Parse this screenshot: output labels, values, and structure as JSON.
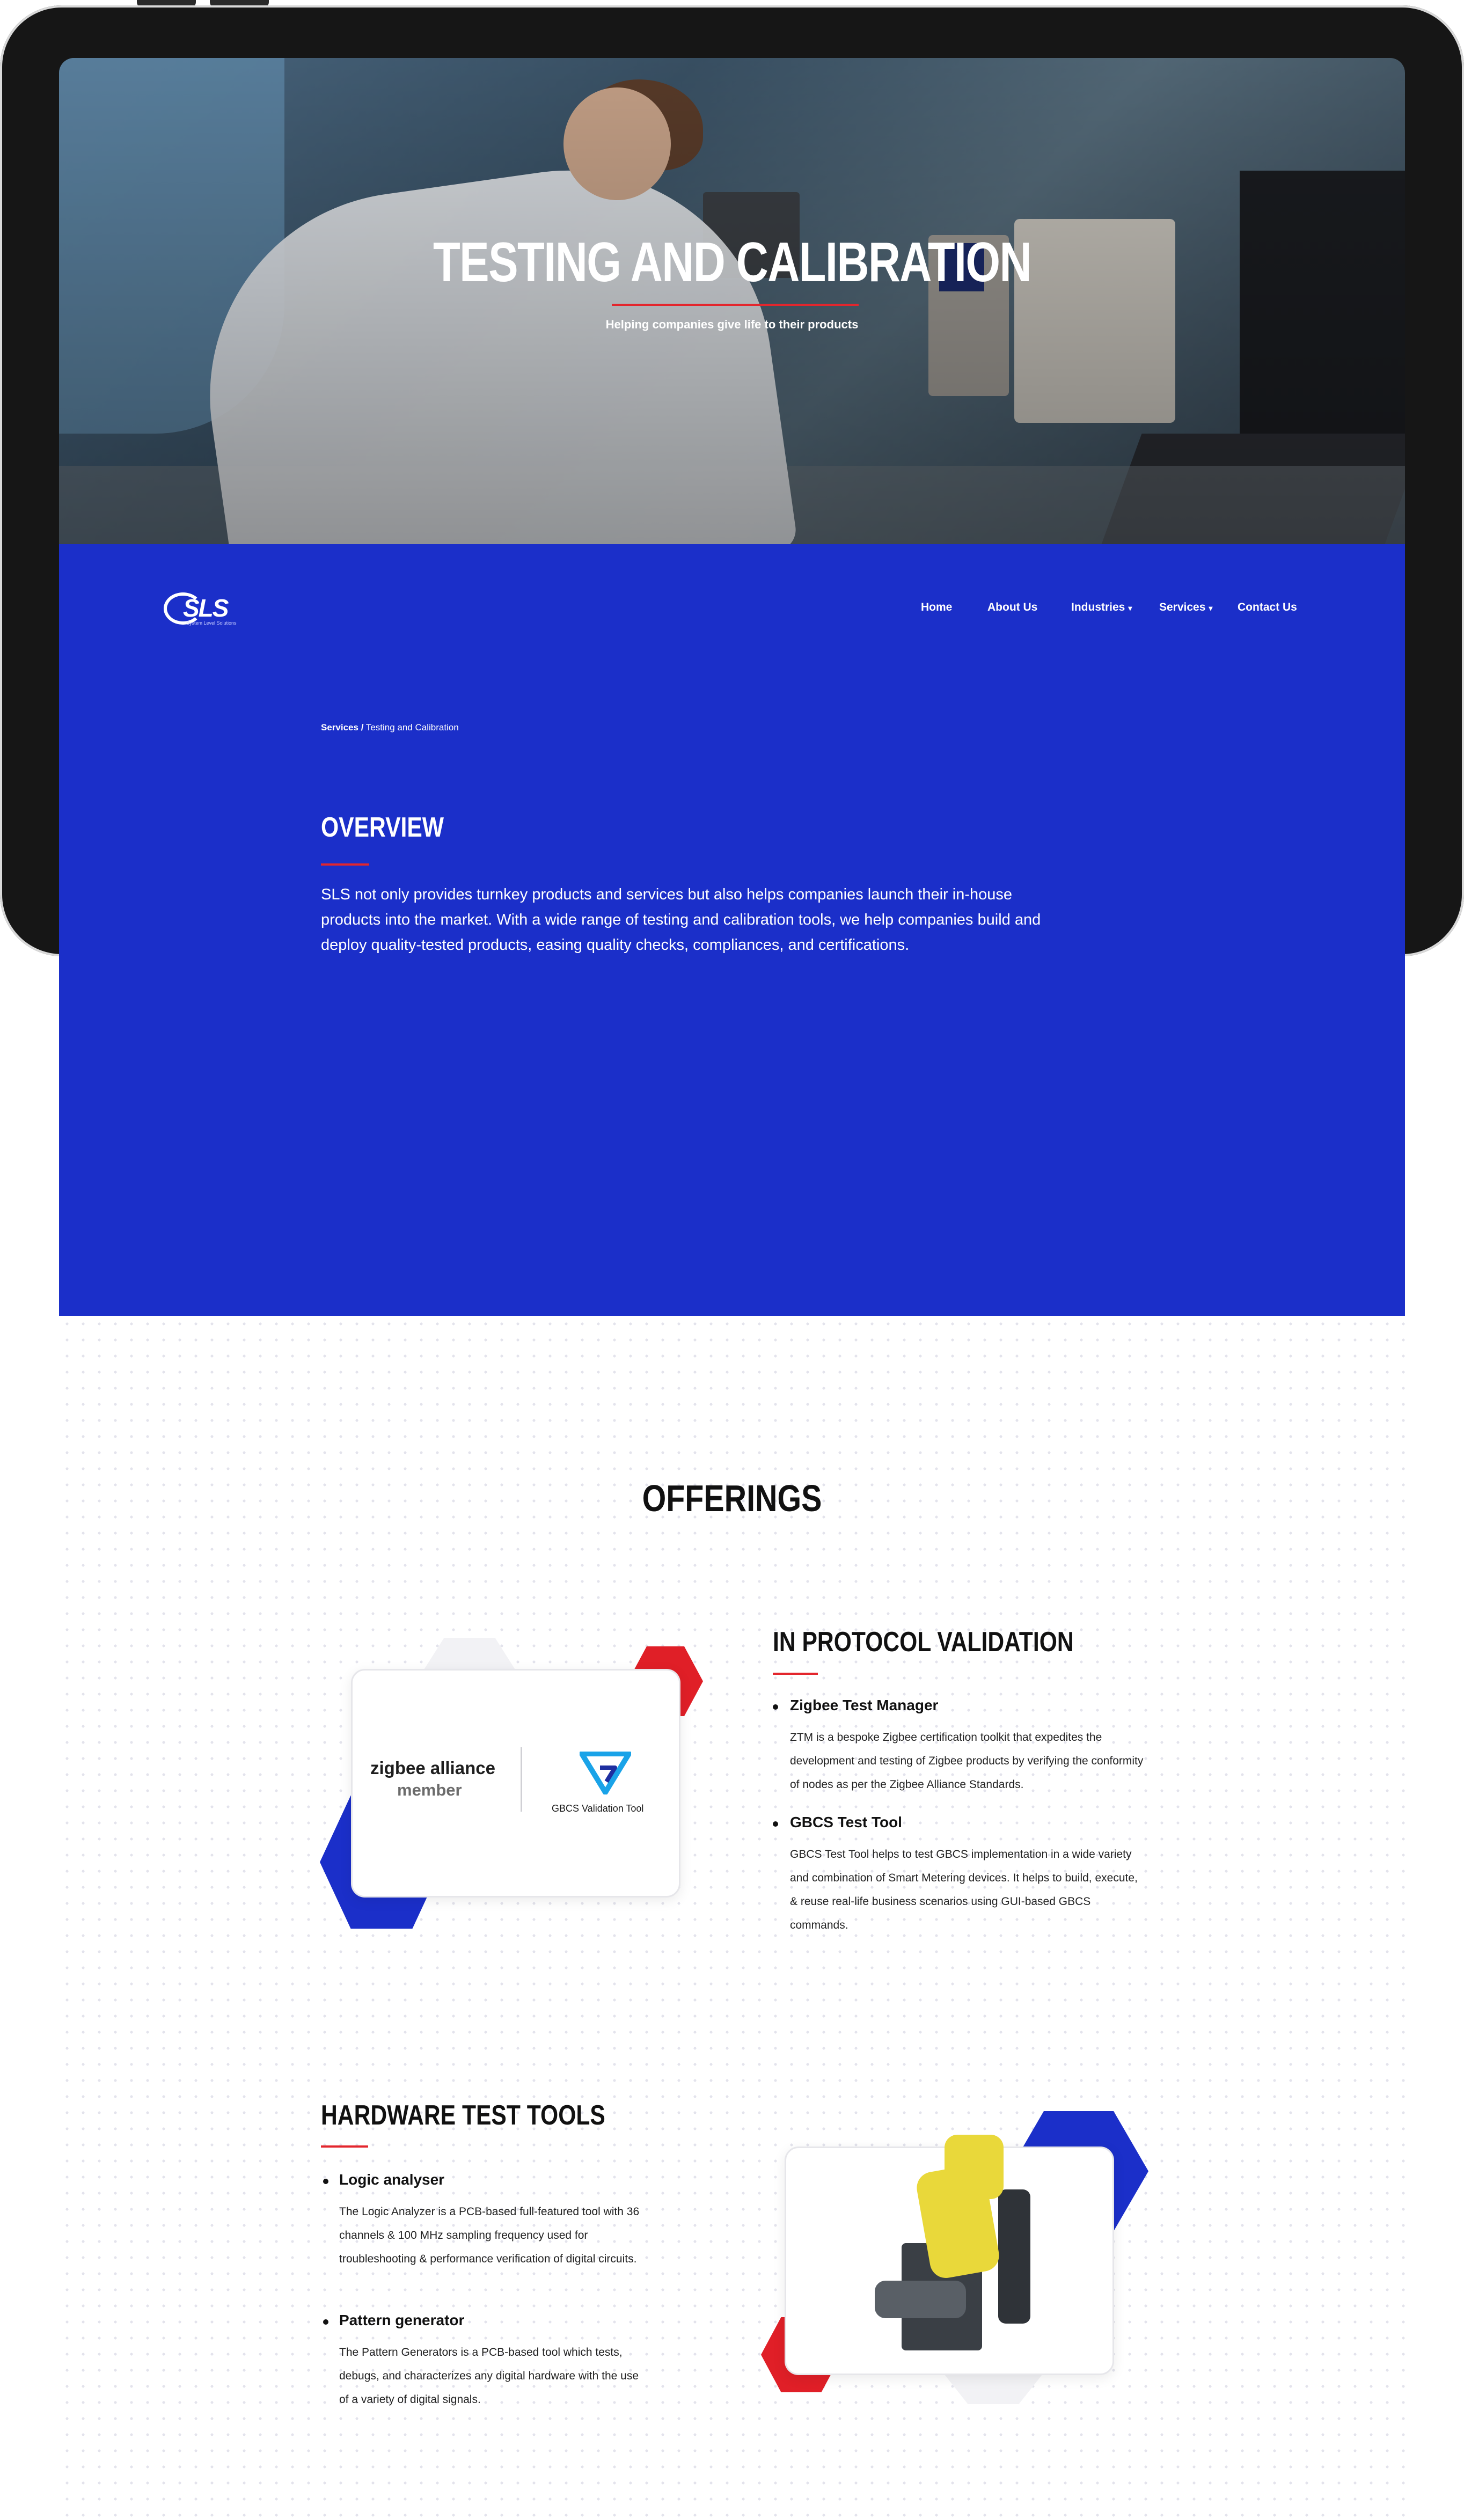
{
  "hero": {
    "title": "TESTING AND CALIBRATION",
    "subtitle": "Helping companies give life to their products"
  },
  "brand": {
    "logo_text": "SLS",
    "tagline": "System Level Solutions"
  },
  "nav": {
    "items": [
      {
        "label": "Home"
      },
      {
        "label": "About Us"
      },
      {
        "label": "Industries",
        "dropdown": true
      },
      {
        "label": "Services",
        "dropdown": true
      },
      {
        "label": "Contact Us"
      }
    ],
    "caret": "▾"
  },
  "breadcrumb": {
    "parent": "Services",
    "separator": "/",
    "current": "Testing and Calibration"
  },
  "overview": {
    "heading": "OVERVIEW",
    "text": "SLS not only provides turnkey products and services but also helps companies launch their in-house products into the market. With a wide range of testing and calibration tools, we help companies build and deploy quality-tested products, easing quality checks, compliances, and certifications."
  },
  "offerings": {
    "title": "OFFERINGS",
    "protocol": {
      "heading": "IN PROTOCOL VALIDATION",
      "items": [
        {
          "title": "Zigbee Test Manager",
          "text": "ZTM is a bespoke Zigbee certification toolkit that expedites the development and testing of Zigbee products by verifying the conformity of nodes as per the Zigbee Alliance Standards."
        },
        {
          "title": "GBCS Test Tool",
          "text": "GBCS Test Tool helps to test GBCS implementation in a wide variety and combination of Smart Metering devices. It helps to build, execute, & reuse real-life business scenarios using GUI-based GBCS commands."
        }
      ],
      "card": {
        "zigbee_line1": "zigbee alliance",
        "zigbee_line2": "member",
        "gbcs_label": "GBCS Validation Tool"
      }
    },
    "hardware": {
      "heading": "HARDWARE TEST TOOLS",
      "items": [
        {
          "title": "Logic analyser",
          "text": "The Logic Analyzer is a PCB-based full-featured tool with 36 channels & 100 MHz sampling frequency used for troubleshooting & performance verification of digital circuits."
        },
        {
          "title": "Pattern generator",
          "text": "The Pattern Generators is a PCB-based tool which tests, debugs, and characterizes any digital hardware with the use of a variety of digital signals."
        }
      ]
    }
  },
  "colors": {
    "brand_blue": "#1b2fc9",
    "accent_red": "#e3262d",
    "gbcs_blue": "#1aa3e8"
  }
}
